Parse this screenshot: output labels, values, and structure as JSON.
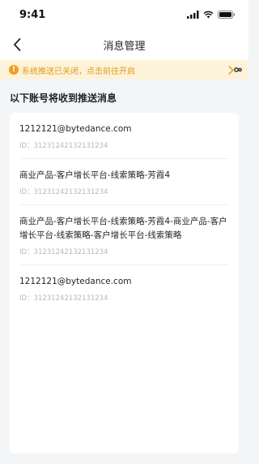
{
  "status_bar": {
    "time": "9:41"
  },
  "nav": {
    "title": "消息管理"
  },
  "banner": {
    "text": "系统推送已关闭，点击前往开启"
  },
  "section": {
    "title": "以下账号将收到推送消息"
  },
  "accounts": [
    {
      "name": "1212121@bytedance.com",
      "id": "ID：31231242132131234"
    },
    {
      "name": "商业产品-客户增长平台-线索策略-芳霞4",
      "id": "ID：31231242132131234"
    },
    {
      "name": "商业产品-客户增长平台-线索策略-芳霞4-商业产品-客户增长平台-线索策略-客户增长平台-线索策略",
      "id": "ID：31231242132131234"
    },
    {
      "name": "1212121@bytedance.com",
      "id": "ID：31231242132131234"
    }
  ],
  "colors": {
    "banner_bg": "#fdf3d9",
    "banner_text": "#e29a20",
    "warn": "#f0a020"
  }
}
